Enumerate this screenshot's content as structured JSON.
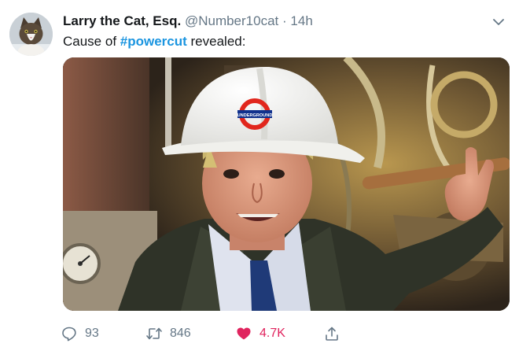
{
  "tweet": {
    "display_name": "Larry the Cat, Esq.",
    "handle": "@Number10cat",
    "separator": "·",
    "timestamp": "14h",
    "text_before": "Cause of ",
    "hashtag": "#powercut",
    "text_after": " revealed:",
    "hard_hat_logo_text": "UNDERGROUND"
  },
  "actions": {
    "replies": "93",
    "retweets": "846",
    "likes": "4.7K",
    "liked": true
  },
  "icons": {
    "avatar": "cat-avatar",
    "menu": "chevron-down-icon",
    "reply": "reply-icon",
    "retweet": "retweet-icon",
    "like": "heart-icon",
    "share": "share-icon"
  },
  "colors": {
    "name_text": "#14171a",
    "secondary_text": "#657786",
    "hashtag": "#1b95e0",
    "like": "#e0245e"
  }
}
